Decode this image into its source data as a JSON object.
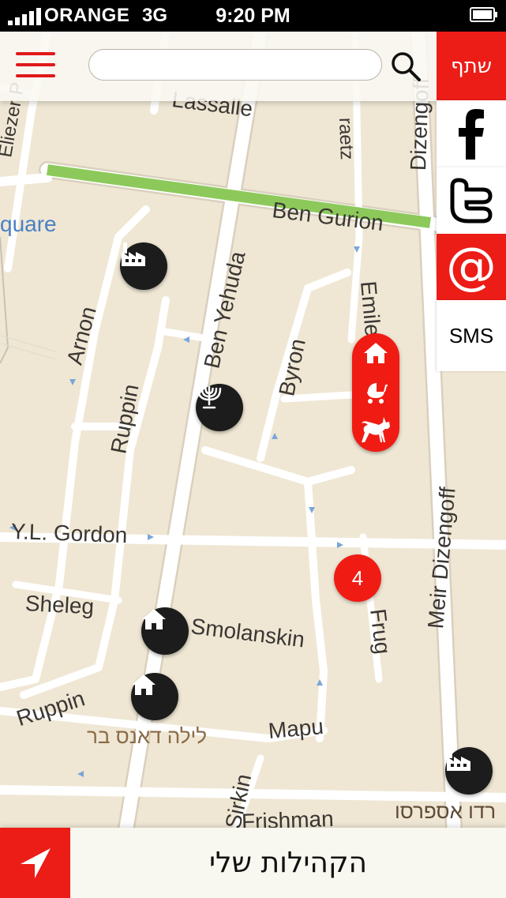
{
  "status_bar": {
    "carrier": "ORANGE",
    "network": "3G",
    "time": "9:20 PM"
  },
  "search": {
    "placeholder": "",
    "value": ""
  },
  "share": {
    "label": "שתף",
    "facebook_icon": "facebook-icon",
    "twitter_icon": "twitter-icon",
    "email_label": "@",
    "sms_label": "SMS"
  },
  "map": {
    "streets": {
      "lassalle": "Lassalle",
      "ben_gurion": "Ben Gurion",
      "ben_yehuda": "Ben Yehuda",
      "arnon": "Arnon",
      "ruppin": "Ruppin",
      "byron": "Byron",
      "emile": "Emile",
      "ruppin2": "Ruppin",
      "yl_gordon": "Y.L. Gordon",
      "sheleg": "Sheleg",
      "smolanskin": "Smolanskin",
      "frug": "Frug",
      "meir_dizengoff": "Meir Dizengoff",
      "mapu": "Mapu",
      "sirkin": "Sirkin",
      "frishman": "Frishman",
      "square": "quare",
      "dizengoff_top": "Dizengoff",
      "raetz": "raetz",
      "eliezer": "Eliezer P"
    },
    "places": {
      "dance_bar": "לילה דאנס בר",
      "cafe": "רדו אספרסו"
    },
    "cluster_count": "4",
    "cluster_icons": [
      "home-icon",
      "stroller-icon",
      "cat-icon"
    ],
    "poi_icons": [
      "factory-icon",
      "menorah-icon",
      "home-icon",
      "home-icon",
      "factory-icon"
    ]
  },
  "bottom": {
    "communities_label": "הקהילות שלי"
  },
  "colors": {
    "accent": "#ec1c17",
    "map_bg": "#efe7d4",
    "road": "#ffffff",
    "park": "#8cc95a"
  }
}
